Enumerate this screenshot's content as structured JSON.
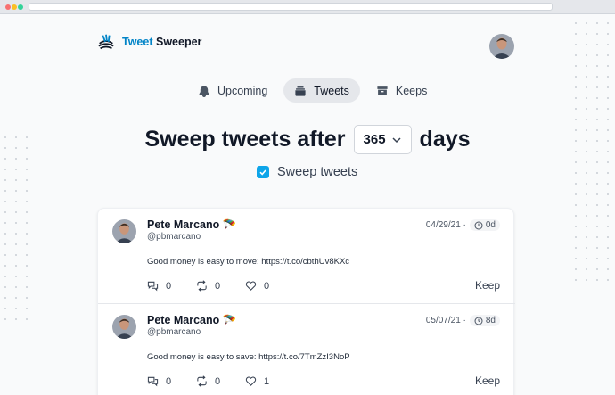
{
  "app": {
    "logo_part1": "Tweet",
    "logo_part2": "Sweeper"
  },
  "nav": {
    "upcoming": "Upcoming",
    "tweets": "Tweets",
    "keeps": "Keeps",
    "active": "tweets"
  },
  "headline": {
    "prefix": "Sweep tweets after",
    "days_value": "365",
    "suffix": "days"
  },
  "sweep_checkbox": {
    "label": "Sweep tweets",
    "checked": true
  },
  "tweets": [
    {
      "name": "Pete Marcano",
      "emoji": "🪂",
      "handle": "@pbmarcano",
      "date": "04/29/21 ·",
      "age": "0d",
      "text": "Good money is easy to move: https://t.co/cbthUv8KXc",
      "replies": "0",
      "retweets": "0",
      "likes": "0",
      "keep_label": "Keep"
    },
    {
      "name": "Pete Marcano",
      "emoji": "🪂",
      "handle": "@pbmarcano",
      "date": "05/07/21 ·",
      "age": "8d",
      "text": "Good money is easy to save: https://t.co/7TmZzI3NoP",
      "replies": "0",
      "retweets": "0",
      "likes": "1",
      "keep_label": "Keep"
    }
  ],
  "colors": {
    "accent": "#0ea5e9",
    "logo_blue": "#0284c7",
    "background": "#f9fafb"
  }
}
